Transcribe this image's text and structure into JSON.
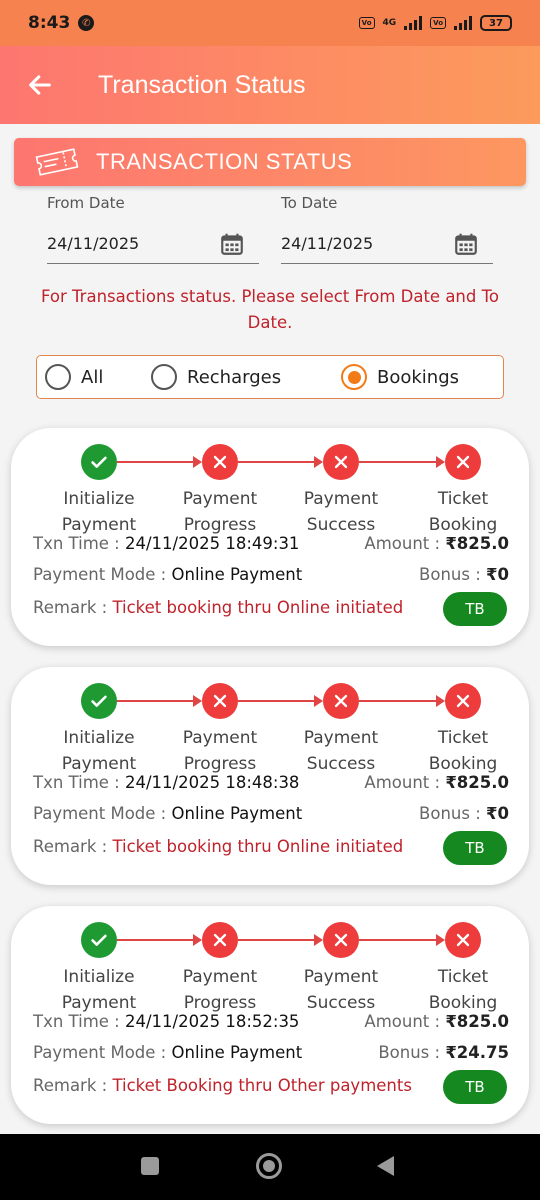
{
  "status_bar": {
    "time": "8:43",
    "battery": "37",
    "network": "4G"
  },
  "app_bar": {
    "title": "Transaction Status"
  },
  "section": {
    "title": "TRANSACTION STATUS"
  },
  "from_date": {
    "label": "From Date",
    "value": "24/11/2025"
  },
  "to_date": {
    "label": "To Date",
    "value": "24/11/2025"
  },
  "hint": "For Transactions status. Please select From Date and To Date.",
  "filter": {
    "options": [
      "All",
      "Recharges",
      "Bookings"
    ],
    "selected": "Bookings"
  },
  "step_labels": [
    [
      "Initialize",
      "Payment"
    ],
    [
      "Payment",
      "Progress"
    ],
    [
      "Payment",
      "Success"
    ],
    [
      "Ticket",
      "Booking"
    ]
  ],
  "field_labels": {
    "txn_time": "Txn Time :",
    "amount": "Amount :",
    "payment_mode": "Payment Mode :",
    "bonus": "Bonus :",
    "remark": "Remark :"
  },
  "transactions": [
    {
      "steps": [
        "done",
        "failed",
        "failed",
        "failed"
      ],
      "txn_time": "24/11/2025 18:49:31",
      "amount": "₹825.0",
      "payment_mode": "Online Payment",
      "bonus": "₹0",
      "remark": "Ticket booking thru Online initiated",
      "badge": "TB"
    },
    {
      "steps": [
        "done",
        "failed",
        "failed",
        "failed"
      ],
      "txn_time": "24/11/2025 18:48:38",
      "amount": "₹825.0",
      "payment_mode": "Online Payment",
      "bonus": "₹0",
      "remark": "Ticket booking thru Online initiated",
      "badge": "TB"
    },
    {
      "steps": [
        "done",
        "failed",
        "failed",
        "failed"
      ],
      "txn_time": "24/11/2025 18:52:35",
      "amount": "₹825.0",
      "payment_mode": "Online Payment",
      "bonus": "₹24.75",
      "remark": "Ticket Booking thru Other payments",
      "badge": "TB"
    }
  ],
  "colors": {
    "accent": "#fd7f68",
    "success": "#1f9a33",
    "failure": "#ee3b3b",
    "remark": "#c0222b",
    "radio_selected": "#f27b18"
  },
  "icons": {
    "back": "arrow-left-icon",
    "ticket": "ticket-icon",
    "calendar": "calendar-icon",
    "done": "check-icon",
    "failed": "cross-icon"
  }
}
